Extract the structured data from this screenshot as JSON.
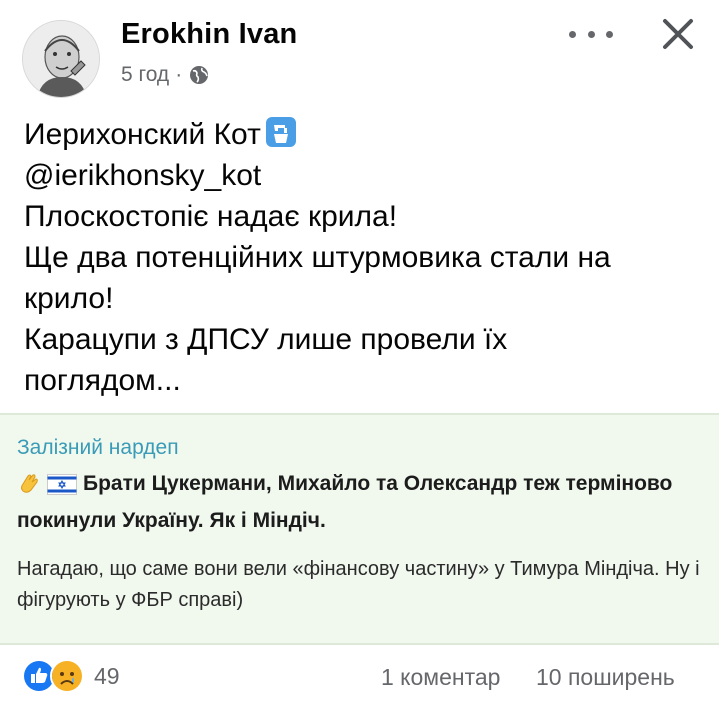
{
  "post": {
    "author": "Erokhin Ivan",
    "time": "5 год",
    "separator": "·",
    "lines": [
      "Иерихонский Кот",
      "@ierikhonsky_kot",
      "Плоскостопіє надає крила!",
      "Ще два потенційних штурмовика стали на",
      "крило!",
      "Карацупи з ДПСУ лише провели їх",
      "поглядом..."
    ]
  },
  "quote": {
    "title": "Залізний нардеп",
    "headline": "Брати Цукермани, Михайло та Олександр теж терміново покинули Україну. Як і Міндіч.",
    "body": "Нагадаю, що саме вони вели «фінансову частину» у Тимура Міндіча. Ну і фігурують у ФБР справі)"
  },
  "footer": {
    "reaction_count": "49",
    "comments": "1 коментар",
    "shares": "10 поширень"
  },
  "icons": {
    "avatar": "avatar",
    "globe": "globe-icon",
    "more": "more-icon",
    "close": "close-icon",
    "water": "potable-water-emoji",
    "wave": "waving-hand-emoji",
    "flag": "israel-flag-emoji",
    "like": "like-reaction-icon",
    "sad": "sad-reaction-icon"
  },
  "colors": {
    "accent_blue": "#1877f2",
    "quote_title": "#3a9bb7",
    "quote_bg": "#f1f8ee",
    "muted": "#65676b"
  }
}
